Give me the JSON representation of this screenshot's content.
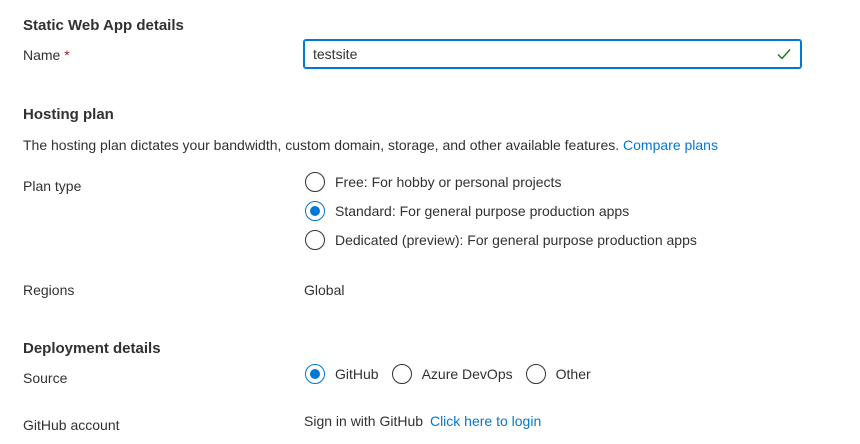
{
  "static_app": {
    "section_title": "Static Web App details",
    "name_label": "Name",
    "required_marker": "*",
    "name_value": "testsite"
  },
  "hosting": {
    "section_title": "Hosting plan",
    "description": "The hosting plan dictates your bandwidth, custom domain, storage, and other available features.",
    "compare_link": "Compare plans",
    "plan_type_label": "Plan type",
    "plan_options": [
      {
        "label": "Free: For hobby or personal projects",
        "selected": false
      },
      {
        "label": "Standard: For general purpose production apps",
        "selected": true
      },
      {
        "label": "Dedicated (preview): For general purpose production apps",
        "selected": false
      }
    ],
    "regions_label": "Regions",
    "regions_value": "Global"
  },
  "deployment": {
    "section_title": "Deployment details",
    "source_label": "Source",
    "source_options": [
      {
        "label": "GitHub",
        "selected": true
      },
      {
        "label": "Azure DevOps",
        "selected": false
      },
      {
        "label": "Other",
        "selected": false
      }
    ],
    "github_account_label": "GitHub account",
    "sign_in_text": "Sign in with GitHub",
    "login_link": "Click here to login"
  },
  "colors": {
    "accent": "#0078d4",
    "valid_check": "#107c10",
    "required": "#a4262c"
  }
}
